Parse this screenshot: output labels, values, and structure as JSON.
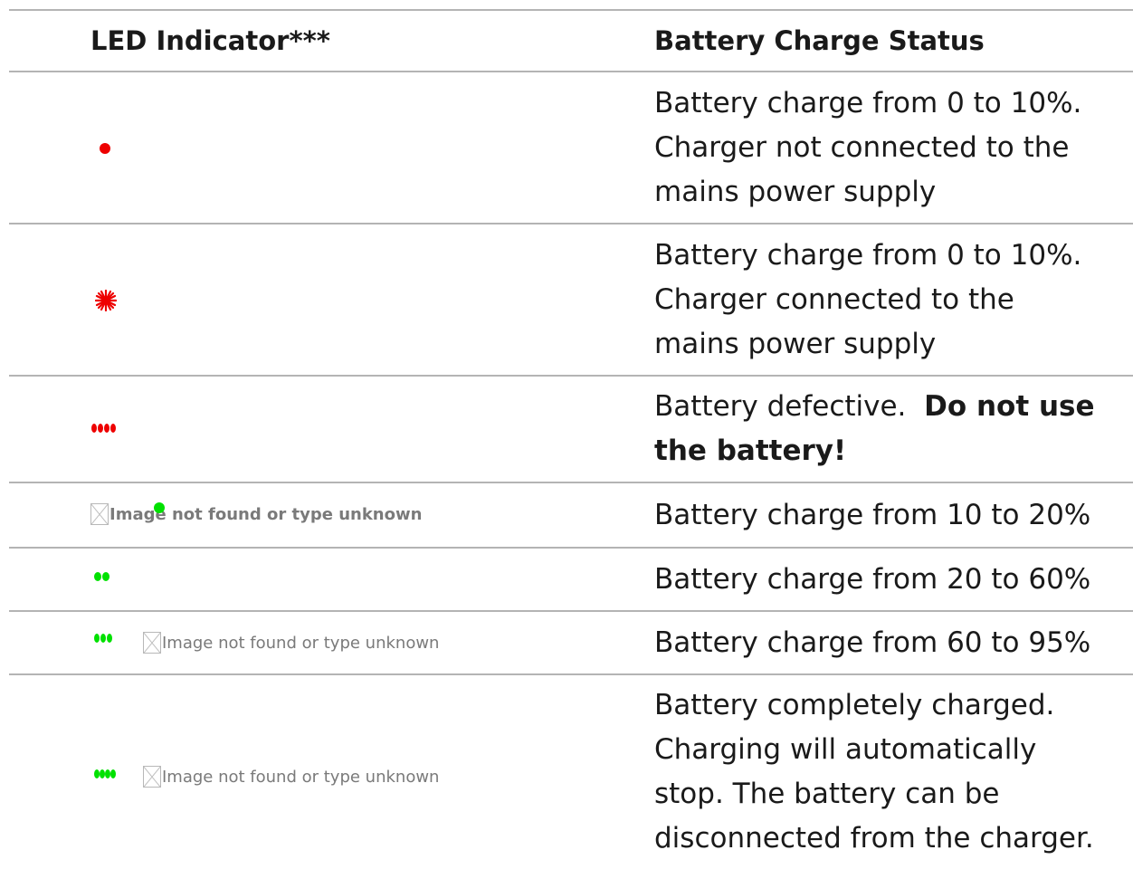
{
  "header": {
    "col1": "LED Indicator***",
    "col2": "Battery Charge Status"
  },
  "rows": [
    {
      "led": "single red dot",
      "status": [
        "Battery charge from 0 to 10%.",
        "Charger not connected to the",
        "mains power supply"
      ]
    },
    {
      "led": "flashing red dot",
      "status": [
        "Battery charge from 0 to 10%.",
        "Charger connected to the",
        "mains power supply"
      ]
    },
    {
      "led": "four red dots",
      "status_plain": "Battery defective.",
      "status_bold1": "Do not use",
      "status_bold2": "the battery!"
    },
    {
      "led": "one green dot",
      "broken_image_text": "Image not found or type unknown",
      "status": [
        "Battery charge from 10 to 20%"
      ]
    },
    {
      "led": "two green dots",
      "status": [
        "Battery charge from 20 to 60%"
      ]
    },
    {
      "led": "three green dots",
      "broken_image_text": "Image not found or type unknown",
      "status": [
        "Battery charge from 60 to 95%"
      ]
    },
    {
      "led": "four green dots",
      "broken_image_text": "Image not found or type unknown",
      "status": [
        "Battery completely charged.",
        "Charging will automatically",
        "stop. The battery can be",
        "disconnected from the charger."
      ]
    }
  ],
  "colors": {
    "red": "#ee0000",
    "green": "#00e100",
    "rule": "#b4b4b4"
  },
  "icons": [
    "red-dot-icon",
    "red-flash-icon",
    "green-dot-icon",
    "broken-image-icon"
  ]
}
